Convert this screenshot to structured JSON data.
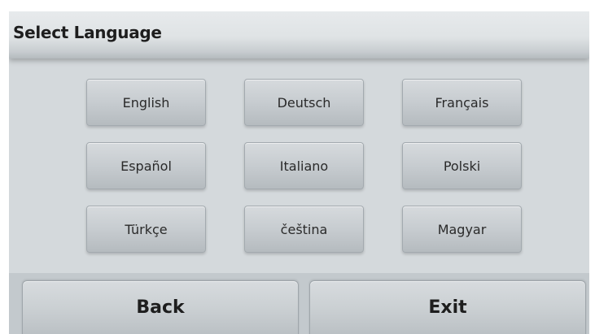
{
  "header": {
    "title": "Select Language"
  },
  "languages": [
    {
      "label": "English"
    },
    {
      "label": "Deutsch"
    },
    {
      "label": "Français"
    },
    {
      "label": "Español"
    },
    {
      "label": "Italiano"
    },
    {
      "label": "Polski"
    },
    {
      "label": "Türkçe"
    },
    {
      "label": "čeština"
    },
    {
      "label": "Magyar"
    }
  ],
  "footer": {
    "back_label": "Back",
    "exit_label": "Exit"
  }
}
